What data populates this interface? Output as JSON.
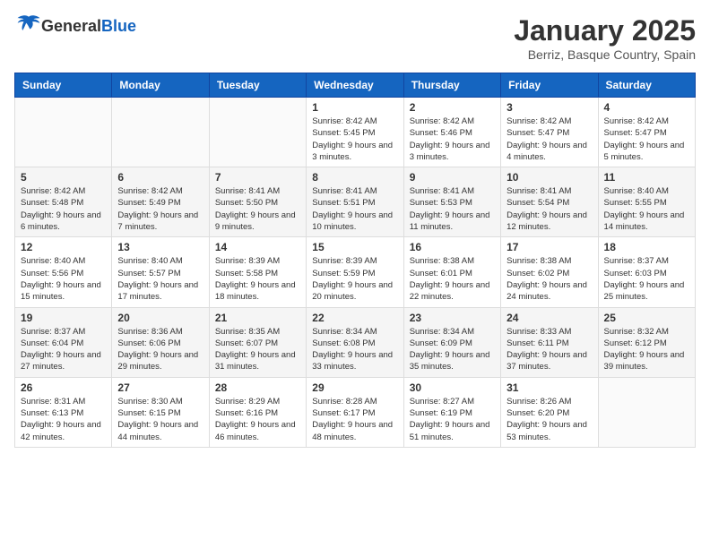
{
  "logo": {
    "general": "General",
    "blue": "Blue"
  },
  "header": {
    "month_title": "January 2025",
    "location": "Berriz, Basque Country, Spain"
  },
  "weekdays": [
    "Sunday",
    "Monday",
    "Tuesday",
    "Wednesday",
    "Thursday",
    "Friday",
    "Saturday"
  ],
  "weeks": [
    [
      {
        "day": "",
        "info": ""
      },
      {
        "day": "",
        "info": ""
      },
      {
        "day": "",
        "info": ""
      },
      {
        "day": "1",
        "info": "Sunrise: 8:42 AM\nSunset: 5:45 PM\nDaylight: 9 hours and 3 minutes."
      },
      {
        "day": "2",
        "info": "Sunrise: 8:42 AM\nSunset: 5:46 PM\nDaylight: 9 hours and 3 minutes."
      },
      {
        "day": "3",
        "info": "Sunrise: 8:42 AM\nSunset: 5:47 PM\nDaylight: 9 hours and 4 minutes."
      },
      {
        "day": "4",
        "info": "Sunrise: 8:42 AM\nSunset: 5:47 PM\nDaylight: 9 hours and 5 minutes."
      }
    ],
    [
      {
        "day": "5",
        "info": "Sunrise: 8:42 AM\nSunset: 5:48 PM\nDaylight: 9 hours and 6 minutes."
      },
      {
        "day": "6",
        "info": "Sunrise: 8:42 AM\nSunset: 5:49 PM\nDaylight: 9 hours and 7 minutes."
      },
      {
        "day": "7",
        "info": "Sunrise: 8:41 AM\nSunset: 5:50 PM\nDaylight: 9 hours and 9 minutes."
      },
      {
        "day": "8",
        "info": "Sunrise: 8:41 AM\nSunset: 5:51 PM\nDaylight: 9 hours and 10 minutes."
      },
      {
        "day": "9",
        "info": "Sunrise: 8:41 AM\nSunset: 5:53 PM\nDaylight: 9 hours and 11 minutes."
      },
      {
        "day": "10",
        "info": "Sunrise: 8:41 AM\nSunset: 5:54 PM\nDaylight: 9 hours and 12 minutes."
      },
      {
        "day": "11",
        "info": "Sunrise: 8:40 AM\nSunset: 5:55 PM\nDaylight: 9 hours and 14 minutes."
      }
    ],
    [
      {
        "day": "12",
        "info": "Sunrise: 8:40 AM\nSunset: 5:56 PM\nDaylight: 9 hours and 15 minutes."
      },
      {
        "day": "13",
        "info": "Sunrise: 8:40 AM\nSunset: 5:57 PM\nDaylight: 9 hours and 17 minutes."
      },
      {
        "day": "14",
        "info": "Sunrise: 8:39 AM\nSunset: 5:58 PM\nDaylight: 9 hours and 18 minutes."
      },
      {
        "day": "15",
        "info": "Sunrise: 8:39 AM\nSunset: 5:59 PM\nDaylight: 9 hours and 20 minutes."
      },
      {
        "day": "16",
        "info": "Sunrise: 8:38 AM\nSunset: 6:01 PM\nDaylight: 9 hours and 22 minutes."
      },
      {
        "day": "17",
        "info": "Sunrise: 8:38 AM\nSunset: 6:02 PM\nDaylight: 9 hours and 24 minutes."
      },
      {
        "day": "18",
        "info": "Sunrise: 8:37 AM\nSunset: 6:03 PM\nDaylight: 9 hours and 25 minutes."
      }
    ],
    [
      {
        "day": "19",
        "info": "Sunrise: 8:37 AM\nSunset: 6:04 PM\nDaylight: 9 hours and 27 minutes."
      },
      {
        "day": "20",
        "info": "Sunrise: 8:36 AM\nSunset: 6:06 PM\nDaylight: 9 hours and 29 minutes."
      },
      {
        "day": "21",
        "info": "Sunrise: 8:35 AM\nSunset: 6:07 PM\nDaylight: 9 hours and 31 minutes."
      },
      {
        "day": "22",
        "info": "Sunrise: 8:34 AM\nSunset: 6:08 PM\nDaylight: 9 hours and 33 minutes."
      },
      {
        "day": "23",
        "info": "Sunrise: 8:34 AM\nSunset: 6:09 PM\nDaylight: 9 hours and 35 minutes."
      },
      {
        "day": "24",
        "info": "Sunrise: 8:33 AM\nSunset: 6:11 PM\nDaylight: 9 hours and 37 minutes."
      },
      {
        "day": "25",
        "info": "Sunrise: 8:32 AM\nSunset: 6:12 PM\nDaylight: 9 hours and 39 minutes."
      }
    ],
    [
      {
        "day": "26",
        "info": "Sunrise: 8:31 AM\nSunset: 6:13 PM\nDaylight: 9 hours and 42 minutes."
      },
      {
        "day": "27",
        "info": "Sunrise: 8:30 AM\nSunset: 6:15 PM\nDaylight: 9 hours and 44 minutes."
      },
      {
        "day": "28",
        "info": "Sunrise: 8:29 AM\nSunset: 6:16 PM\nDaylight: 9 hours and 46 minutes."
      },
      {
        "day": "29",
        "info": "Sunrise: 8:28 AM\nSunset: 6:17 PM\nDaylight: 9 hours and 48 minutes."
      },
      {
        "day": "30",
        "info": "Sunrise: 8:27 AM\nSunset: 6:19 PM\nDaylight: 9 hours and 51 minutes."
      },
      {
        "day": "31",
        "info": "Sunrise: 8:26 AM\nSunset: 6:20 PM\nDaylight: 9 hours and 53 minutes."
      },
      {
        "day": "",
        "info": ""
      }
    ]
  ]
}
